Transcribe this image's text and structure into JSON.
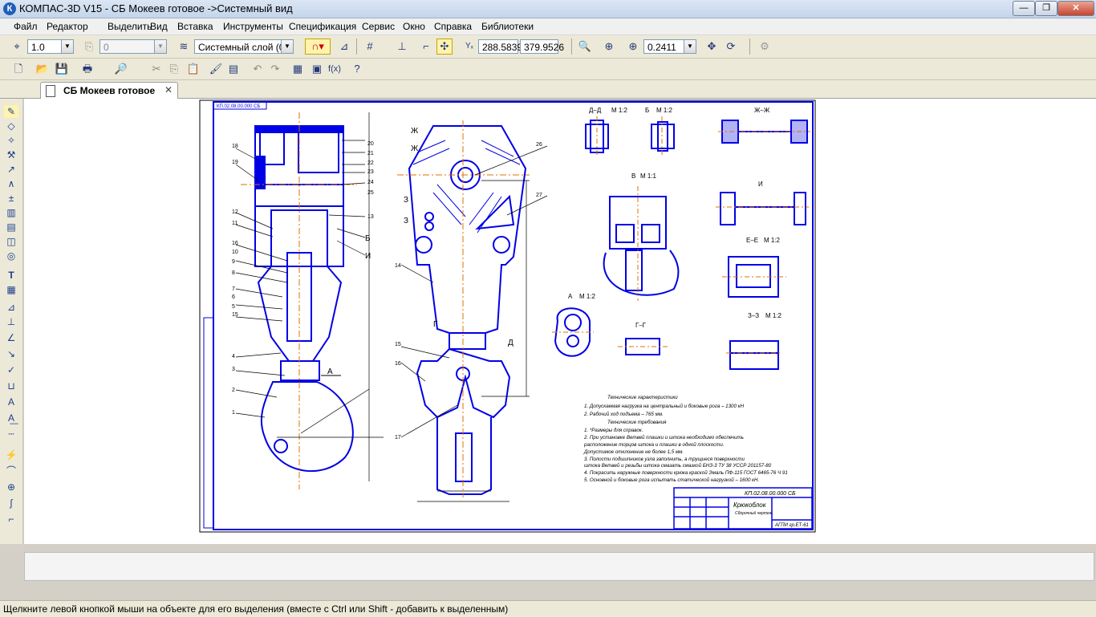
{
  "window": {
    "title": "КОМПАС-3D V15 - СБ Мокеев готовое ->Системный вид",
    "app_icon": "К"
  },
  "menu": [
    "Файл",
    "Редактор",
    "Выделить",
    "Вид",
    "Вставка",
    "Инструменты",
    "Спецификация",
    "Сервис",
    "Окно",
    "Справка",
    "Библиотеки"
  ],
  "toolbar1": {
    "scale": "1.0",
    "layer_num": "0",
    "layer_name": "Системный слой (0)",
    "coord_x": "288.5839",
    "coord_y": "379.9526",
    "zoom": "0.2411"
  },
  "tab": {
    "label": "СБ Мокеев готовое"
  },
  "drawing": {
    "sec_dd": "Д–Д",
    "sec_b": "Б",
    "sec_zhzh": "Ж–Ж",
    "view_v": "В",
    "view_i": "И",
    "sec_ee": "Е–Е",
    "view_a": "А",
    "sec_gg": "Г–Г",
    "sec_zz": "З–З",
    "scale_12": "М 1:2",
    "scale_11": "М 1:1",
    "tech_title": "Технические характеристики",
    "tech_lines": [
      "1. Допускаемая нагрузка на центральный и боковые рога – 1300 кН",
      "2. Рабочий ход подъема – 765 мм.",
      "Технические требования",
      "1. *Размеры для справок.",
      "2. При установке Ветвей плашки и штока необходимо обеспечить",
      "расположение торцов штока и плашки в одной плоскости.",
      "Допустимое отклонение не более 1,5 мм.",
      "3. Полости подшипников узла заполнить, а трущиеся поверхности",
      "штока Ветвей и резьбы штока смазать смазкой БНЗ-3 ТУ 38 УССР 201157-80",
      "4. Покрасить наружные поверхности крюка краской Эмаль ПФ-115 ГОСТ 6465-76 Ч 91",
      "5. Основной и боковые рога испытать статической нагрузкой – 1600 кН."
    ],
    "stamp_code": "КП.02.08.00.000 СБ",
    "stamp_name": "Крюкоблок",
    "stamp_sub": "Сборочный чертеж",
    "stamp_org": "АГПИ гр.ЕТ-61",
    "top_code": "КП.02.08.00.000 СБ"
  },
  "status_text": "Щелкните левой кнопкой мыши на объекте для его выделения (вместе с Ctrl или Shift - добавить к выделенным)",
  "colors": {
    "drawing_line": "#0000e6",
    "axis_line": "#e07000",
    "accent": "#1f5fb8"
  }
}
